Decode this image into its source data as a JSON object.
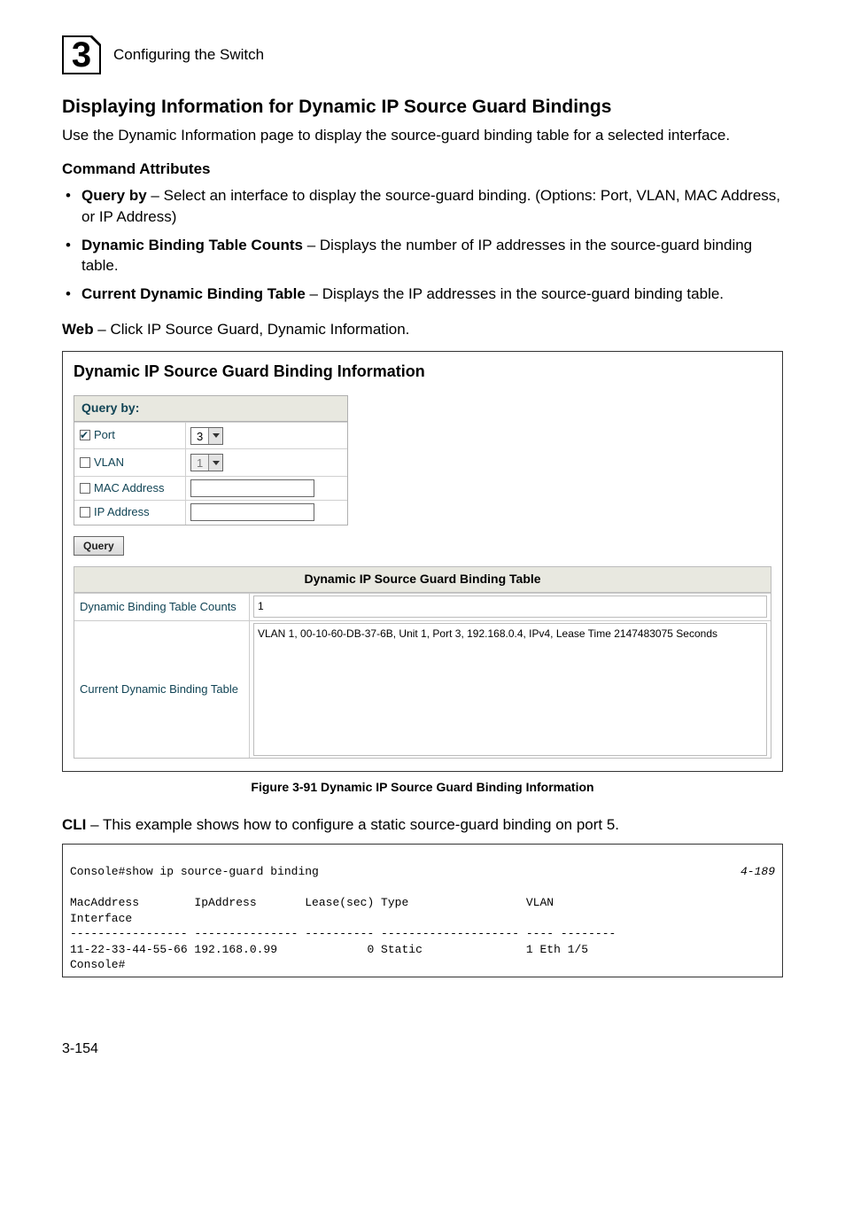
{
  "chapter": {
    "number": "3",
    "running_head": "Configuring the Switch"
  },
  "section": {
    "title": "Displaying Information for Dynamic IP Source Guard Bindings",
    "intro": "Use the Dynamic Information page to display the source-guard binding table for a selected interface."
  },
  "attributes": {
    "heading": "Command Attributes",
    "items": [
      {
        "name": "Query by",
        "desc": " – Select an interface to display the source-guard binding. (Options: Port, VLAN, MAC Address, or IP Address)"
      },
      {
        "name": "Dynamic Binding Table Counts",
        "desc": " – Displays the number of IP addresses in the source-guard binding table."
      },
      {
        "name": "Current Dynamic Binding Table",
        "desc": " – Displays the IP addresses in the source-guard binding table."
      }
    ]
  },
  "web": {
    "prefix": "Web",
    "text": " – Click IP Source Guard, Dynamic Information."
  },
  "screenshot": {
    "title": "Dynamic IP Source Guard Binding Information",
    "query_heading": "Query by:",
    "rows": {
      "port_label": "Port",
      "port_value": "3",
      "vlan_label": "VLAN",
      "vlan_value": "1",
      "mac_label": "MAC Address",
      "ip_label": "IP Address"
    },
    "query_button": "Query",
    "results_heading": "Dynamic IP Source Guard Binding Table",
    "counts_label": "Dynamic Binding Table Counts",
    "counts_value": "1",
    "current_label": "Current Dynamic Binding Table",
    "current_value": "VLAN 1, 00-10-60-DB-37-6B, Unit 1, Port 3, 192.168.0.4, IPv4, Lease Time 2147483075 Seconds"
  },
  "figure_caption": "Figure 3-91  Dynamic IP Source Guard Binding Information",
  "cli": {
    "prefix": "CLI",
    "text": " – This example shows how to configure a static source-guard binding on port 5.",
    "ref": "4-189",
    "lines": {
      "l1_left": "Console#show ip source-guard binding",
      "l2": "MacAddress        IpAddress       Lease(sec) Type                 VLAN",
      "l3": "Interface",
      "l4": "----------------- --------------- ---------- -------------------- ---- --------",
      "l5": "11-22-33-44-55-66 192.168.0.99             0 Static               1 Eth 1/5",
      "l6": "Console#"
    }
  },
  "page_number": "3-154"
}
